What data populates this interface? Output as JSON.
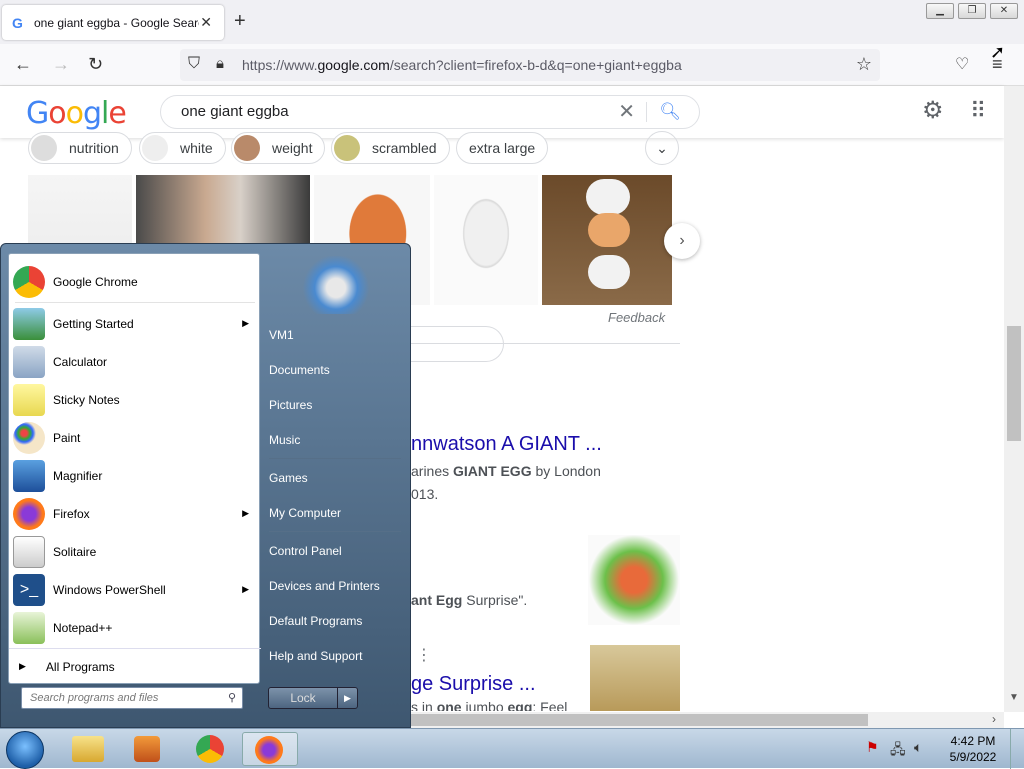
{
  "browser": {
    "tab_title": "one giant eggba - Google Search",
    "tab_favicon": "google-g-icon",
    "url_prefix": "https://www.",
    "url_domain": "google.com",
    "url_path": "/search?client=firefox-b-d&q=one+giant+eggba"
  },
  "google": {
    "logo": "Google",
    "query": "one giant eggba",
    "chips": [
      "nutrition",
      "white",
      "weight",
      "scrambled",
      "extra large"
    ],
    "feedback": "Feedback",
    "results": [
      {
        "title_partial": "nnwatson A GIANT ...",
        "snippet_1_pre": "arines ",
        "snippet_1_bold": "GIANT EGG",
        "snippet_1_post": " by London",
        "snippet_2": "013."
      },
      {
        "snippet_pre": "ant Egg",
        "snippet_post": " Surprise\"."
      },
      {
        "title_partial": "ge Surprise ...",
        "snippet_pre": "s in ",
        "snippet_bold": "one",
        "snippet_mid": " jumbo ",
        "snippet_bold2": "egg",
        "snippet_post": "; Feel"
      }
    ]
  },
  "start_menu": {
    "programs": [
      {
        "label": "Google Chrome",
        "submenu": false,
        "icon": "chrome-icon"
      },
      {
        "label": "Getting Started",
        "submenu": true,
        "icon": "getting-started-icon"
      },
      {
        "label": "Calculator",
        "submenu": false,
        "icon": "calculator-icon"
      },
      {
        "label": "Sticky Notes",
        "submenu": false,
        "icon": "sticky-notes-icon"
      },
      {
        "label": "Paint",
        "submenu": false,
        "icon": "paint-icon"
      },
      {
        "label": "Magnifier",
        "submenu": false,
        "icon": "magnifier-icon"
      },
      {
        "label": "Firefox",
        "submenu": true,
        "icon": "firefox-icon"
      },
      {
        "label": "Solitaire",
        "submenu": false,
        "icon": "solitaire-icon"
      },
      {
        "label": "Windows PowerShell",
        "submenu": true,
        "icon": "powershell-icon"
      },
      {
        "label": "Notepad++",
        "submenu": false,
        "icon": "notepadpp-icon"
      }
    ],
    "all_programs": "All Programs",
    "search_placeholder": "Search programs and files",
    "right_items": [
      "VM1",
      "Documents",
      "Pictures",
      "Music",
      "Games",
      "My Computer",
      "Control Panel",
      "Devices and Printers",
      "Default Programs",
      "Help and Support"
    ],
    "lock_label": "Lock"
  },
  "taskbar": {
    "time": "4:42 PM",
    "date": "5/9/2022"
  }
}
